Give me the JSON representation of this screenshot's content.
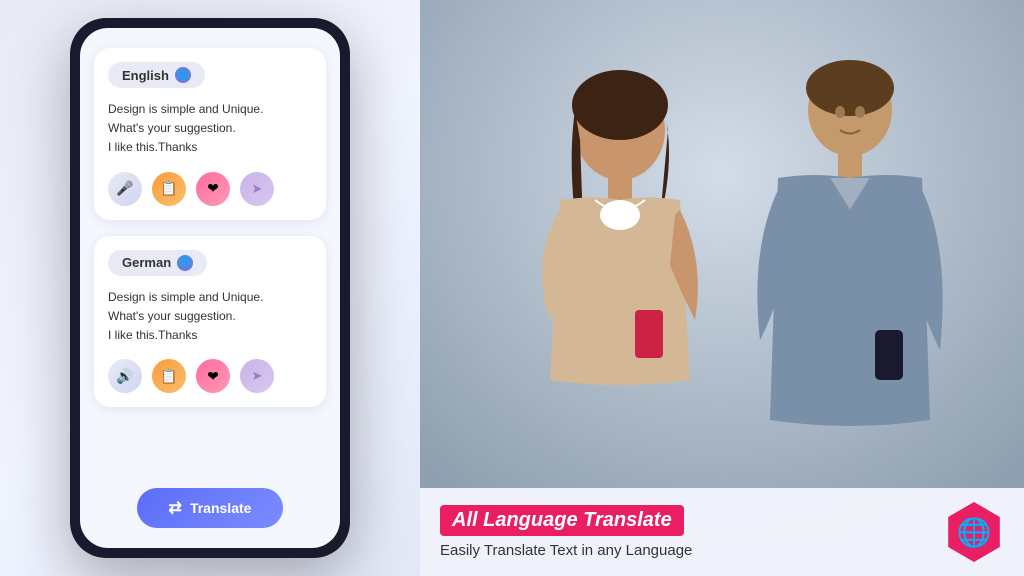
{
  "left_panel": {
    "background": "#e8eaf6"
  },
  "phone": {
    "source_card": {
      "language": "English",
      "text_line1": "Design is simple and Unique.",
      "text_line2": "What's your suggestion.",
      "text_line3": "I like this.Thanks"
    },
    "target_card": {
      "language": "German",
      "text_line1": "Design is simple and Unique.",
      "text_line2": "What's your suggestion.",
      "text_line3": "I like this.Thanks"
    },
    "translate_button": "Translate"
  },
  "banner": {
    "title": "All Language Translate",
    "subtitle": "Easily Translate Text in any  Language",
    "logo_icon": "🌐"
  },
  "action_buttons": {
    "mic": "🎤",
    "copy": "📋",
    "heart": "❤",
    "share": "↗"
  }
}
